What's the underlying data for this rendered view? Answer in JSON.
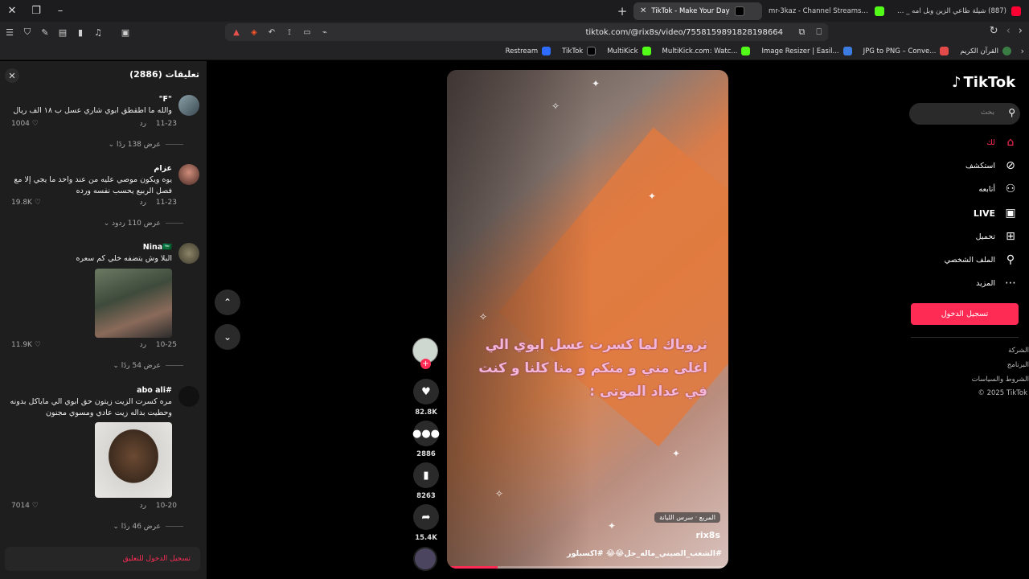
{
  "browser": {
    "tabs": [
      {
        "title": "TikTok - Make Your Day",
        "active": true
      },
      {
        "title": "mr-3kaz - Channel Streams on Kick",
        "active": false
      },
      {
        "title": "(887) شيلة طاعي الزين وبل امه _ اداء",
        "active": false
      }
    ],
    "url": "tiktok.com/@rix8s/video/7558159891828198664",
    "bookmarks": [
      {
        "label": "Restream",
        "color": "#2d6cff"
      },
      {
        "label": "TikTok",
        "color": "#000000"
      },
      {
        "label": "MultiKick",
        "color": "#53fc18"
      },
      {
        "label": "MultiKick.com: Watc...",
        "color": "#53fc18"
      },
      {
        "label": "Image Resizer | Easil...",
        "color": "#3c7be0"
      },
      {
        "label": "JPG to PNG – Conve...",
        "color": "#e34b4b"
      },
      {
        "label": "القرآن الكريم",
        "color": "#3a7d44"
      }
    ]
  },
  "comments_panel": {
    "title": "تعليقات (2886)",
    "login_prompt": "تسجيل الدخول للتعليق",
    "items": [
      {
        "name": "\"F\"",
        "text": "والله ما اطقطق ابوي شاري عسل ب ١٨ الف ريال",
        "date": "11-23",
        "reply": "رد",
        "likes": "1004",
        "replies": "عرض 138 ردًا"
      },
      {
        "name": "عزام",
        "text": "يوه ويكون موصي عليه من عند واحد ما يجي إلا مع فصل الربيع يحسب نفسه ورده",
        "date": "11-23",
        "reply": "رد",
        "likes": "19.8K",
        "replies": "عرض 110 ردود"
      },
      {
        "name": "Nina🇸🇦",
        "text": "البلا وش يتضفه خلي كم سعره",
        "date": "10-25",
        "reply": "رد",
        "likes": "11.9K",
        "replies": "عرض 54 ردًا"
      },
      {
        "name": "#abo ali",
        "text": "مره كسرت الزيت زيتون حق ابوي الي ماياكل بدونه وحطيت بداله زيت عادي ومسوي مجنون",
        "date": "10-20",
        "reply": "رد",
        "likes": "7014",
        "replies": "عرض 46 ردًا"
      }
    ]
  },
  "video": {
    "overlay_text": "ثروباك لما كسرت عسل ابوي الي اغلى مني و منكم و منا كلنا و كنت في عداد الموتى :",
    "music": "المربع · سرس الليانة",
    "username": "rix8s",
    "caption": "#الشعب_الصيني_ماله_حل😂😂 #اكسبلور",
    "progress": 0.18
  },
  "actions": {
    "likes": "82.8K",
    "comments": "2886",
    "saves": "8263",
    "shares": "15.4K"
  },
  "sidebar": {
    "logo": "TikTok",
    "search_placeholder": "بحث",
    "nav": [
      {
        "label": "لك",
        "icon": "home-icon",
        "active": true
      },
      {
        "label": "استكشف",
        "icon": "compass-icon",
        "active": false
      },
      {
        "label": "أتابعه",
        "icon": "following-icon",
        "active": false
      },
      {
        "label": "LIVE",
        "icon": "live-icon",
        "active": false
      },
      {
        "label": "تحميل",
        "icon": "upload-icon",
        "active": false
      },
      {
        "label": "الملف الشخصي",
        "icon": "profile-icon",
        "active": false
      },
      {
        "label": "المزيد",
        "icon": "more-icon",
        "active": false
      }
    ],
    "login_button": "تسجيل الدخول",
    "footer": [
      "الشركة",
      "البرنامج",
      "الشروط والسياسات"
    ],
    "copyright": "© 2025 TikTok"
  },
  "colors": {
    "accent": "#fe2c55",
    "panel": "#1e1e1e",
    "background": "#000000"
  }
}
